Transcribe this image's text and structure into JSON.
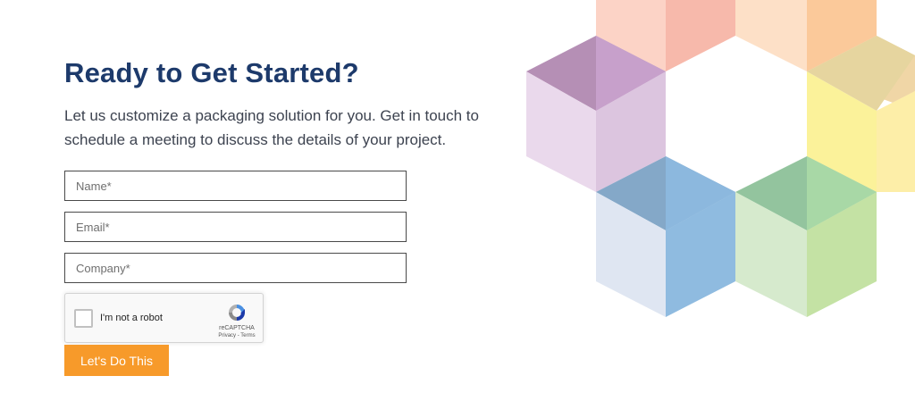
{
  "heading": "Ready to Get Started?",
  "subtitle": "Let us customize a packaging solution for you. Get in touch to schedule a meeting to discuss the details of your project.",
  "form": {
    "name_placeholder": "Name*",
    "email_placeholder": "Email*",
    "company_placeholder": "Company*",
    "submit_label": "Let's Do This"
  },
  "recaptcha": {
    "label": "I'm not a robot",
    "brand": "reCAPTCHA",
    "links": "Privacy - Terms"
  },
  "colors": {
    "heading": "#1d3a6b",
    "button": "#f79a2a",
    "cube_purple": "#c9a4cf",
    "cube_blue": "#8fbbe0",
    "cube_green": "#c4e2a4",
    "cube_yellow": "#fbf29a",
    "cube_pink": "#f7b9ab",
    "cube_peach": "#fbd2a4"
  }
}
